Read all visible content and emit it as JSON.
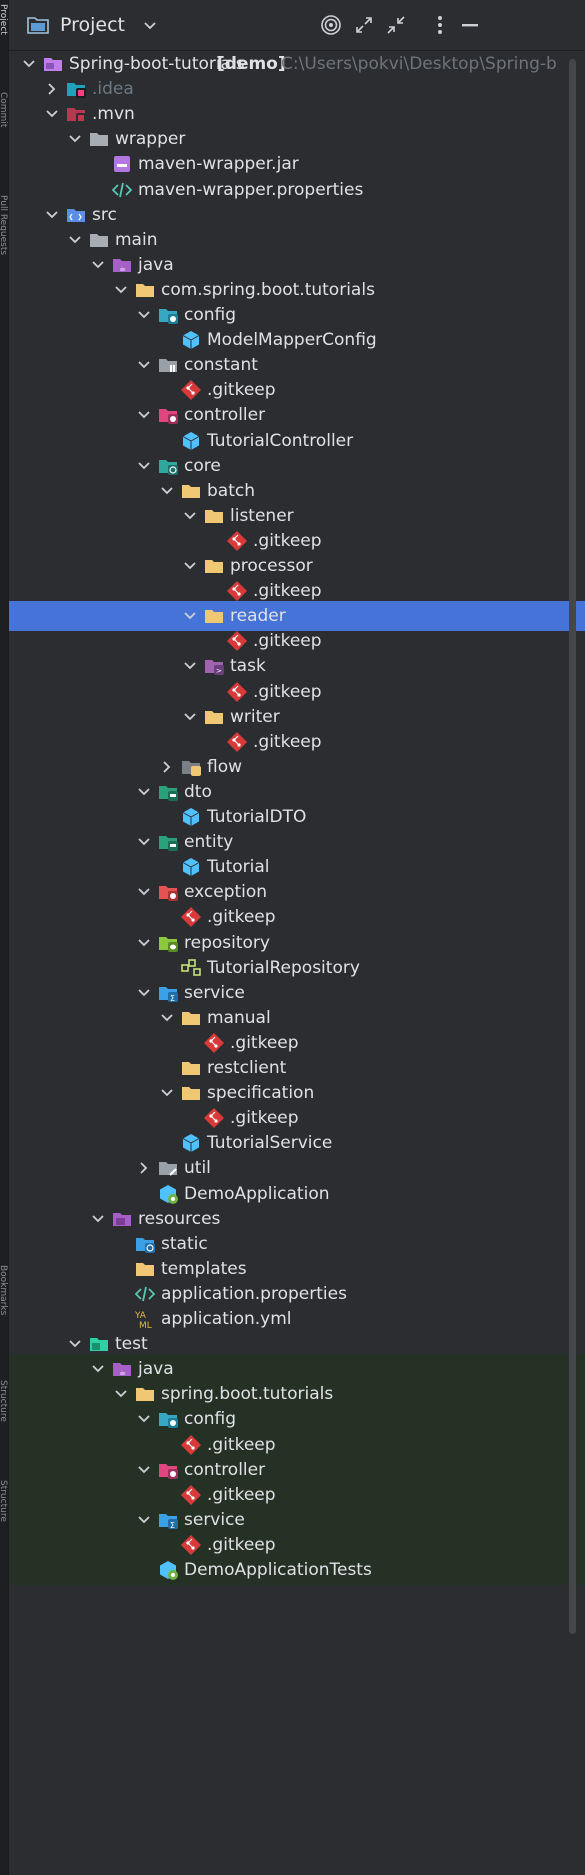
{
  "stripe": {
    "tabs": [
      "Project",
      "Commit",
      "Pull Requests",
      "Bookmarks",
      "Structure",
      "Structure"
    ]
  },
  "header": {
    "title": "Project",
    "icons": [
      "project-folder-icon",
      "chevron-down-icon",
      "locate-target-icon",
      "expand-all-icon",
      "collapse-all-icon",
      "more-options-icon",
      "hide-panel-icon"
    ]
  },
  "colors": {
    "background": "#2b2d30",
    "selected_row": "#4573d7",
    "test_rows": "#263126",
    "folder": "#f0c873",
    "java_class": "#4fc1ff",
    "gitkeep": "#d83a3a"
  },
  "tree": [
    {
      "label": "Spring-boot-tutorials",
      "bold": "[demo]",
      "path": "C:\\Users\\pokvi\\Desktop\\Spring-b",
      "depth": 0,
      "arrow": "down",
      "icon": "module-folder"
    },
    {
      "label": ".idea",
      "depth": 1,
      "arrow": "right",
      "icon": "idea-folder",
      "dim": true
    },
    {
      "label": ".mvn",
      "depth": 1,
      "arrow": "down",
      "icon": "mvn-folder"
    },
    {
      "label": "wrapper",
      "depth": 2,
      "arrow": "down",
      "icon": "plain-folder"
    },
    {
      "label": "maven-wrapper.jar",
      "depth": 3,
      "arrow": "none",
      "icon": "jar"
    },
    {
      "label": "maven-wrapper.properties",
      "depth": 3,
      "arrow": "none",
      "icon": "properties"
    },
    {
      "label": "src",
      "depth": 1,
      "arrow": "down",
      "icon": "src-folder"
    },
    {
      "label": "main",
      "depth": 2,
      "arrow": "down",
      "icon": "plain-folder"
    },
    {
      "label": "java",
      "depth": 3,
      "arrow": "down",
      "icon": "java-folder"
    },
    {
      "label": "com.spring.boot.tutorials",
      "depth": 4,
      "arrow": "down",
      "icon": "package"
    },
    {
      "label": "config",
      "depth": 5,
      "arrow": "down",
      "icon": "config-package"
    },
    {
      "label": "ModelMapperConfig",
      "depth": 6,
      "arrow": "none",
      "icon": "class"
    },
    {
      "label": "constant",
      "depth": 5,
      "arrow": "down",
      "icon": "constant-package"
    },
    {
      "label": ".gitkeep",
      "depth": 6,
      "arrow": "none",
      "icon": "gitkeep"
    },
    {
      "label": "controller",
      "depth": 5,
      "arrow": "down",
      "icon": "controller-package"
    },
    {
      "label": "TutorialController",
      "depth": 6,
      "arrow": "none",
      "icon": "class"
    },
    {
      "label": "core",
      "depth": 5,
      "arrow": "down",
      "icon": "core-package"
    },
    {
      "label": "batch",
      "depth": 6,
      "arrow": "down",
      "icon": "package"
    },
    {
      "label": "listener",
      "depth": 7,
      "arrow": "down",
      "icon": "package"
    },
    {
      "label": ".gitkeep",
      "depth": 8,
      "arrow": "none",
      "icon": "gitkeep"
    },
    {
      "label": "processor",
      "depth": 7,
      "arrow": "down",
      "icon": "package"
    },
    {
      "label": ".gitkeep",
      "depth": 8,
      "arrow": "none",
      "icon": "gitkeep"
    },
    {
      "label": "reader",
      "depth": 7,
      "arrow": "down",
      "icon": "package",
      "selected": true
    },
    {
      "label": ".gitkeep",
      "depth": 8,
      "arrow": "none",
      "icon": "gitkeep"
    },
    {
      "label": "task",
      "depth": 7,
      "arrow": "down",
      "icon": "task-package"
    },
    {
      "label": ".gitkeep",
      "depth": 8,
      "arrow": "none",
      "icon": "gitkeep"
    },
    {
      "label": "writer",
      "depth": 7,
      "arrow": "down",
      "icon": "package"
    },
    {
      "label": ".gitkeep",
      "depth": 8,
      "arrow": "none",
      "icon": "gitkeep"
    },
    {
      "label": "flow",
      "depth": 6,
      "arrow": "right",
      "icon": "flow-package"
    },
    {
      "label": "dto",
      "depth": 5,
      "arrow": "down",
      "icon": "dto-package"
    },
    {
      "label": "TutorialDTO",
      "depth": 6,
      "arrow": "none",
      "icon": "class"
    },
    {
      "label": "entity",
      "depth": 5,
      "arrow": "down",
      "icon": "entity-package"
    },
    {
      "label": "Tutorial",
      "depth": 6,
      "arrow": "none",
      "icon": "class"
    },
    {
      "label": "exception",
      "depth": 5,
      "arrow": "down",
      "icon": "exception-package"
    },
    {
      "label": ".gitkeep",
      "depth": 6,
      "arrow": "none",
      "icon": "gitkeep"
    },
    {
      "label": "repository",
      "depth": 5,
      "arrow": "down",
      "icon": "repository-package"
    },
    {
      "label": "TutorialRepository",
      "depth": 6,
      "arrow": "none",
      "icon": "repository"
    },
    {
      "label": "service",
      "depth": 5,
      "arrow": "down",
      "icon": "service-package"
    },
    {
      "label": "manual",
      "depth": 6,
      "arrow": "down",
      "icon": "package"
    },
    {
      "label": ".gitkeep",
      "depth": 7,
      "arrow": "none",
      "icon": "gitkeep"
    },
    {
      "label": "restclient",
      "depth": 6,
      "arrow": "none",
      "icon": "package"
    },
    {
      "label": "specification",
      "depth": 6,
      "arrow": "down",
      "icon": "package"
    },
    {
      "label": ".gitkeep",
      "depth": 7,
      "arrow": "none",
      "icon": "gitkeep"
    },
    {
      "label": "TutorialService",
      "depth": 6,
      "arrow": "none",
      "icon": "class"
    },
    {
      "label": "util",
      "depth": 5,
      "arrow": "right",
      "icon": "util-package"
    },
    {
      "label": "DemoApplication",
      "depth": 5,
      "arrow": "none",
      "icon": "spring-class"
    },
    {
      "label": "resources",
      "depth": 3,
      "arrow": "down",
      "icon": "resources-folder"
    },
    {
      "label": "static",
      "depth": 4,
      "arrow": "none",
      "icon": "static-folder"
    },
    {
      "label": "templates",
      "depth": 4,
      "arrow": "none",
      "icon": "templates-folder"
    },
    {
      "label": "application.properties",
      "depth": 4,
      "arrow": "none",
      "icon": "properties"
    },
    {
      "label": "application.yml",
      "depth": 4,
      "arrow": "none",
      "icon": "yaml"
    },
    {
      "label": "test",
      "depth": 2,
      "arrow": "down",
      "icon": "test-folder"
    },
    {
      "label": "java",
      "depth": 3,
      "arrow": "down",
      "icon": "java-test-folder",
      "test": true
    },
    {
      "label": "spring.boot.tutorials",
      "depth": 4,
      "arrow": "down",
      "icon": "package",
      "test": true
    },
    {
      "label": "config",
      "depth": 5,
      "arrow": "down",
      "icon": "config-package",
      "test": true
    },
    {
      "label": ".gitkeep",
      "depth": 6,
      "arrow": "none",
      "icon": "gitkeep",
      "test": true
    },
    {
      "label": "controller",
      "depth": 5,
      "arrow": "down",
      "icon": "controller-package",
      "test": true
    },
    {
      "label": ".gitkeep",
      "depth": 6,
      "arrow": "none",
      "icon": "gitkeep",
      "test": true
    },
    {
      "label": "service",
      "depth": 5,
      "arrow": "down",
      "icon": "service-package",
      "test": true
    },
    {
      "label": ".gitkeep",
      "depth": 6,
      "arrow": "none",
      "icon": "gitkeep",
      "test": true
    },
    {
      "label": "DemoApplicationTests",
      "depth": 5,
      "arrow": "none",
      "icon": "spring-class",
      "test": true
    }
  ]
}
